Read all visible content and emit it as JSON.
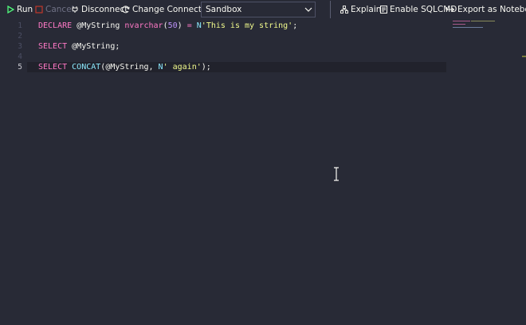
{
  "toolbar": {
    "run_label": "Run",
    "cancel_label": "Cancel",
    "disconnect_label": "Disconnect",
    "change_connection_label": "Change Connection",
    "connection_value": "Sandbox",
    "explain_label": "Explain",
    "sqlcmd_label": "Enable SQLCMD",
    "export_label": "Export as Notebook"
  },
  "editor": {
    "line_numbers": [
      "1",
      "2",
      "3",
      "4",
      "5"
    ],
    "active_line": "5",
    "lines": [
      {
        "tokens": [
          {
            "t": "DECLARE",
            "c": "kw"
          },
          {
            "t": " ",
            "c": "var"
          },
          {
            "t": "@MyString",
            "c": "var"
          },
          {
            "t": " ",
            "c": "var"
          },
          {
            "t": "nvarchar",
            "c": "kw"
          },
          {
            "t": "(",
            "c": "punc"
          },
          {
            "t": "50",
            "c": "num"
          },
          {
            "t": ") ",
            "c": "punc"
          },
          {
            "t": "=",
            "c": "kw"
          },
          {
            "t": " ",
            "c": "var"
          },
          {
            "t": "N",
            "c": "fn"
          },
          {
            "t": "'This is my string'",
            "c": "str"
          },
          {
            "t": ";",
            "c": "punc"
          }
        ]
      },
      {
        "tokens": []
      },
      {
        "tokens": [
          {
            "t": "SELECT",
            "c": "kw"
          },
          {
            "t": " ",
            "c": "var"
          },
          {
            "t": "@MyString",
            "c": "var"
          },
          {
            "t": ";",
            "c": "punc"
          }
        ]
      },
      {
        "tokens": []
      },
      {
        "tokens": [
          {
            "t": "SELECT",
            "c": "kw"
          },
          {
            "t": " ",
            "c": "var"
          },
          {
            "t": "CONCAT",
            "c": "fn"
          },
          {
            "t": "(",
            "c": "punc"
          },
          {
            "t": "@MyString",
            "c": "var"
          },
          {
            "t": ", ",
            "c": "punc"
          },
          {
            "t": "N",
            "c": "fn"
          },
          {
            "t": "' again'",
            "c": "str"
          },
          {
            "t": ");",
            "c": "punc"
          }
        ]
      }
    ]
  },
  "colors": {
    "background": "#282a36",
    "keyword": "#ff79c6",
    "function": "#8be9fd",
    "number": "#bd93f9",
    "string": "#f1fa8c",
    "run_icon": "#50fa7b",
    "cancel_icon": "#ff5555"
  },
  "icons": {
    "run": "play-icon",
    "cancel": "stop-icon",
    "disconnect": "plug-icon",
    "change_connection": "refresh-icon",
    "dropdown": "chevron-down-icon",
    "explain": "tree-icon",
    "sqlcmd": "document-icon",
    "export": "export-icon",
    "text_cursor": "ibeam-icon"
  }
}
